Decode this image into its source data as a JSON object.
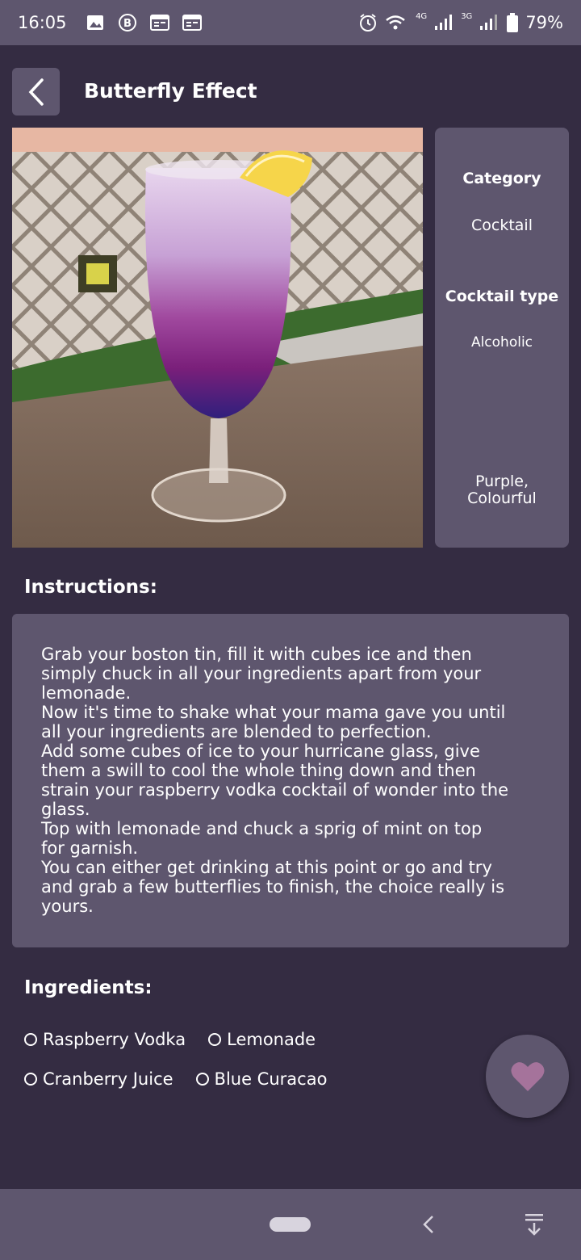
{
  "status_bar": {
    "time": "16:05",
    "network_1": "4G",
    "network_2": "3G",
    "battery": "79%",
    "icons": [
      "image-icon",
      "b-badge-icon",
      "calendar-icon",
      "calendar-icon",
      "alarm-icon",
      "wifi-icon",
      "signal-icon",
      "signal-icon",
      "battery-icon"
    ]
  },
  "header": {
    "title": "Butterfly Effect",
    "back_icon": "chevron-left-icon"
  },
  "info": {
    "category_label": "Category",
    "category_value": "Cocktail",
    "type_label": "Cocktail type",
    "type_value": "Alcoholic",
    "tags": "Purple,\nColourful"
  },
  "instructions": {
    "title": "Instructions:",
    "text": "Grab your boston tin, fill it with cubes ice and then\nsimply chuck in all your ingredients apart from your\nlemonade.\nNow it's time to shake what your mama gave you until\nall your ingredients are blended to perfection.\nAdd some cubes of ice to your hurricane glass, give\nthem a swill to cool the whole thing down and then\nstrain your raspberry vodka cocktail of wonder into the\nglass.\nTop with lemonade and chuck a sprig of mint on top\nfor garnish.\nYou can either get drinking at this point or go and try\nand grab a few butterflies to finish, the choice really is\nyours."
  },
  "ingredients": {
    "title": "Ingredients:",
    "items": [
      "Raspberry Vodka",
      "Lemonade",
      "Cranberry Juice",
      "Blue Curacao"
    ]
  },
  "fab": {
    "icon": "heart-icon"
  },
  "nav": {
    "icons": [
      "home-pill-icon",
      "back-icon",
      "menu-down-icon"
    ]
  },
  "colors": {
    "background": "#342c42",
    "surface": "#5e566e",
    "heart": "#a5739b"
  }
}
